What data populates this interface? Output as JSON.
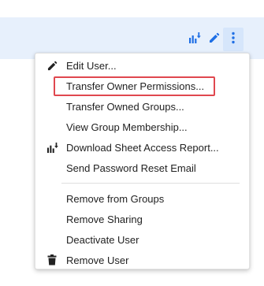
{
  "row_actions": {
    "report_icon": "download-report-icon",
    "edit_icon": "pencil-icon",
    "more_icon": "more-vertical-icon",
    "accent": "#1f6fe5"
  },
  "menu": {
    "group1": [
      {
        "label": "Edit User...",
        "icon": "pencil-icon"
      },
      {
        "label": "Transfer Owner Permissions...",
        "highlighted": true
      },
      {
        "label": "Transfer Owned Groups..."
      },
      {
        "label": "View Group Membership..."
      },
      {
        "label": "Download Sheet Access Report...",
        "icon": "download-report-icon"
      },
      {
        "label": "Send Password Reset Email"
      }
    ],
    "group2": [
      {
        "label": "Remove from Groups"
      },
      {
        "label": "Remove Sharing"
      },
      {
        "label": "Deactivate User"
      },
      {
        "label": "Remove User",
        "icon": "trash-icon"
      }
    ]
  },
  "colors": {
    "row_highlight": "#e7f0fc",
    "annotation_red": "#e0484f",
    "text": "#222222"
  }
}
